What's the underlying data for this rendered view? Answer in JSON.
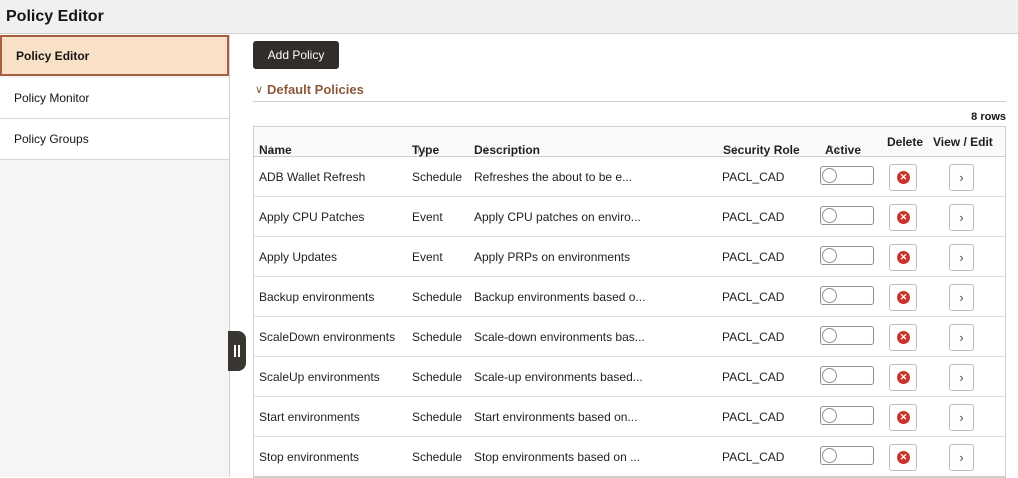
{
  "app": {
    "title": "Policy Editor"
  },
  "sidebar": {
    "items": [
      {
        "label": "Policy Editor",
        "active": true
      },
      {
        "label": "Policy Monitor",
        "active": false
      },
      {
        "label": "Policy Groups",
        "active": false
      }
    ]
  },
  "toolbar": {
    "add_label": "Add Policy"
  },
  "section": {
    "title": "Default Policies",
    "row_count": "8 rows"
  },
  "table": {
    "headers": {
      "name": "Name",
      "type": "Type",
      "description": "Description",
      "security_role": "Security Role",
      "active": "Active",
      "delete": "Delete",
      "view_edit": "View / Edit"
    },
    "sort_glyph": "↑↓",
    "rows": [
      {
        "name": "ADB Wallet Refresh",
        "type": "Schedule",
        "description": "Refreshes the about to be e...",
        "role": "PACL_CAD",
        "active": false
      },
      {
        "name": "Apply CPU Patches",
        "type": "Event",
        "description": "Apply CPU patches on enviro...",
        "role": "PACL_CAD",
        "active": false
      },
      {
        "name": "Apply Updates",
        "type": "Event",
        "description": "Apply PRPs on environments",
        "role": "PACL_CAD",
        "active": false
      },
      {
        "name": "Backup environments",
        "type": "Schedule",
        "description": "Backup environments based o...",
        "role": "PACL_CAD",
        "active": false
      },
      {
        "name": "ScaleDown environments",
        "type": "Schedule",
        "description": "Scale-down environments bas...",
        "role": "PACL_CAD",
        "active": false
      },
      {
        "name": "ScaleUp environments",
        "type": "Schedule",
        "description": "Scale-up environments based...",
        "role": "PACL_CAD",
        "active": false
      },
      {
        "name": "Start environments",
        "type": "Schedule",
        "description": "Start environments based on...",
        "role": "PACL_CAD",
        "active": false
      },
      {
        "name": "Stop environments",
        "type": "Schedule",
        "description": "Stop environments based on ...",
        "role": "PACL_CAD",
        "active": false
      }
    ]
  },
  "icons": {
    "delete": "delete-circle-x-icon",
    "view": "chevron-right-icon",
    "collapse": "chevron-down-icon",
    "splitter": "pane-splitter-icon"
  },
  "colors": {
    "accent": "#8b5a3c",
    "active_bg": "#f8e1c7",
    "active_border": "#a85f3f",
    "primary_button": "#312d2a",
    "delete_red": "#c8352b"
  }
}
